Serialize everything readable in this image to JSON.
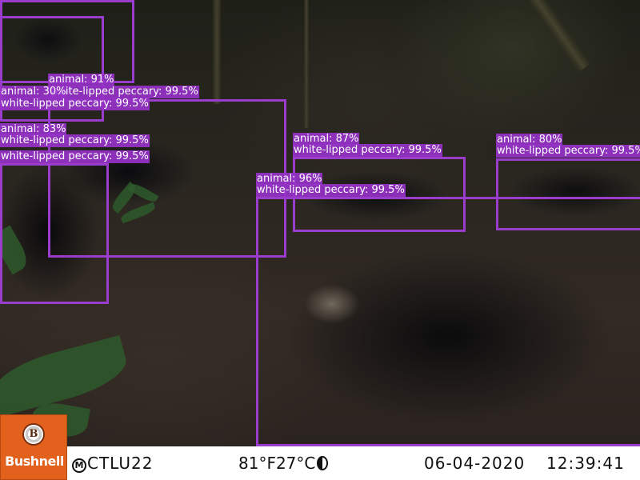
{
  "detections": [
    {
      "id": "d1",
      "labels": []
    },
    {
      "id": "d2",
      "labels": [
        "animal: 91%",
        "white-lipped peccary: 99.5%"
      ]
    },
    {
      "id": "d3",
      "labels": [
        "animal: 30%",
        "white-lipped peccary: 99.5%"
      ]
    },
    {
      "id": "d4",
      "labels": [
        "animal: 83%",
        "white-lipped peccary: 99.5%",
        "white-lipped peccary: 99.5%"
      ]
    },
    {
      "id": "d5",
      "labels": [
        "animal: 87%",
        "white-lipped peccary: 99.5%"
      ]
    },
    {
      "id": "d6",
      "labels": [
        "animal: 80%",
        "white-lipped peccary: 99.5%"
      ]
    },
    {
      "id": "d7",
      "labels": [
        "animal: 96%",
        "white-lipped peccary: 99.5%"
      ]
    }
  ],
  "colors": {
    "box_stroke": "#9a3ccc",
    "label_background": "#9632c8",
    "label_text": "#ffffff",
    "brand": "#e2611c"
  },
  "camera_info": {
    "brand": "Bushnell",
    "camera_id": "CTLU22",
    "temperature": "81°F27°C",
    "date": "06-04-2020",
    "time": "12:39:41",
    "moon_icon": "moon-phase-icon",
    "mode_icon": "m-circle-icon",
    "mode_letter": "M"
  }
}
